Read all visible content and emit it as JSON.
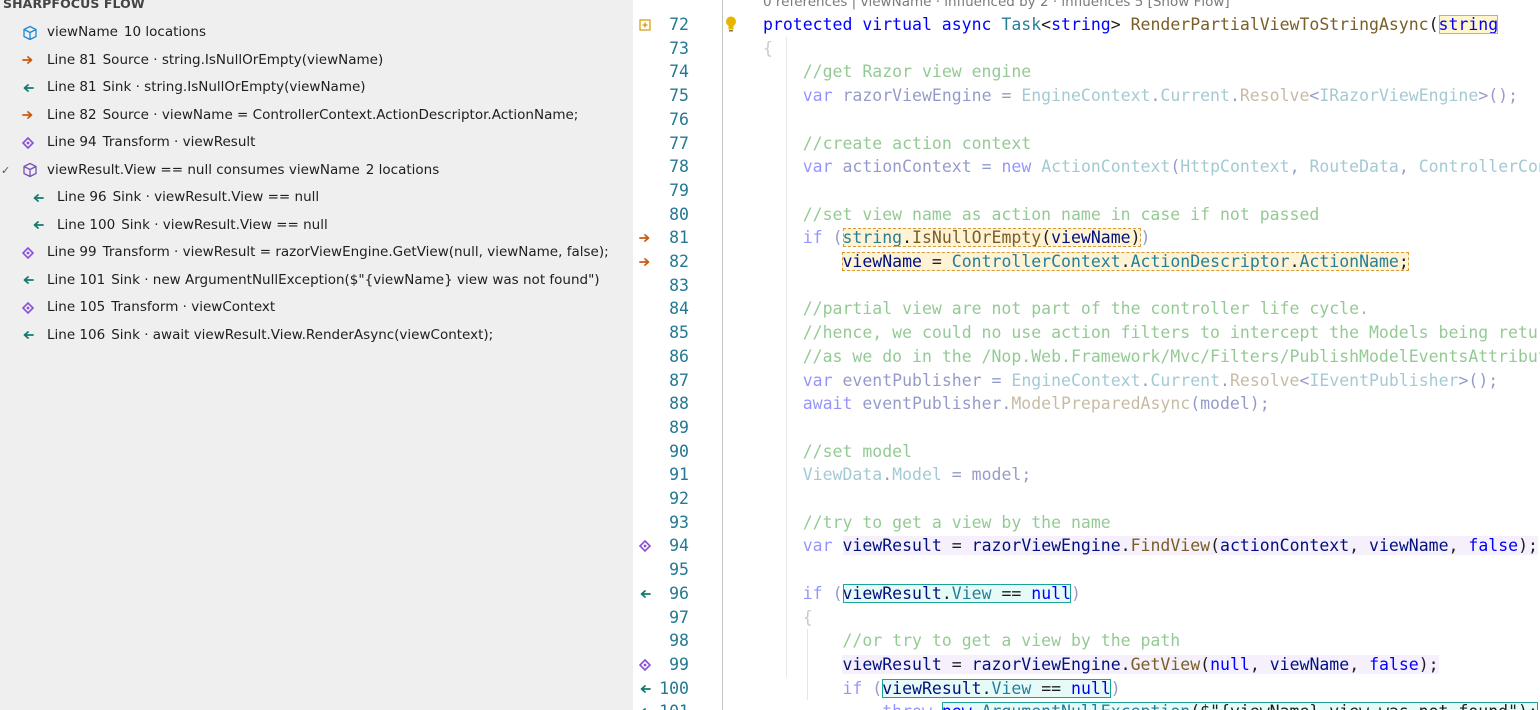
{
  "flow_panel": {
    "title": "SHARPFOCUS FLOW",
    "rows": [
      {
        "kind": "symbol",
        "checked": false,
        "indent": 0,
        "icon": "cube-icon",
        "text": "viewName",
        "count": "10 locations"
      },
      {
        "kind": "source",
        "indent": 0,
        "icon": "arrow-right-icon",
        "line": "Line 81",
        "text": "Source · string.IsNullOrEmpty(viewName)"
      },
      {
        "kind": "sink",
        "indent": 0,
        "icon": "arrow-left-icon",
        "line": "Line 81",
        "text": "Sink · string.IsNullOrEmpty(viewName)"
      },
      {
        "kind": "source",
        "indent": 0,
        "icon": "arrow-right-icon",
        "line": "Line 82",
        "text": "Source · viewName = ControllerContext.ActionDescriptor.ActionName;"
      },
      {
        "kind": "transform",
        "indent": 0,
        "icon": "diamond-icon",
        "line": "Line 94",
        "text": "Transform · viewResult"
      },
      {
        "kind": "symbol",
        "checked": true,
        "indent": 0,
        "icon": "cube-icon",
        "text": "viewResult.View == null consumes viewName",
        "count": "2 locations"
      },
      {
        "kind": "sink",
        "indent": 1,
        "icon": "arrow-left-icon",
        "line": "Line 96",
        "text": "Sink · viewResult.View == null"
      },
      {
        "kind": "sink",
        "indent": 1,
        "icon": "arrow-left-icon",
        "line": "Line 100",
        "text": "Sink · viewResult.View == null"
      },
      {
        "kind": "transform",
        "indent": 0,
        "icon": "diamond-icon",
        "line": "Line 99",
        "text": "Transform · viewResult = razorViewEngine.GetView(null, viewName, false);"
      },
      {
        "kind": "sink",
        "indent": 0,
        "icon": "arrow-left-icon",
        "line": "Line 101",
        "text": "Sink · new ArgumentNullException($\"{viewName} view was not found\")"
      },
      {
        "kind": "transform",
        "indent": 0,
        "icon": "diamond-icon",
        "line": "Line 105",
        "text": "Transform · viewContext"
      },
      {
        "kind": "sink",
        "indent": 0,
        "icon": "arrow-left-icon",
        "line": "Line 106",
        "text": "Sink · await viewResult.View.RenderAsync(viewContext);"
      }
    ]
  },
  "editor": {
    "codelens": "0 references | viewName · influenced by 2 · influences 5 [Show Flow]",
    "lines": [
      {
        "n": "72",
        "glyph": "fold-plus-icon",
        "tokens": [
          [
            "kw",
            "protected virtual async "
          ],
          [
            "ty",
            "Task"
          ],
          [
            "pl",
            "<"
          ],
          [
            "kw",
            "string"
          ],
          [
            "pl",
            "> "
          ],
          [
            "mt",
            "RenderPartialViewToStringAsync"
          ],
          [
            "pl",
            "("
          ],
          [
            "hp:kw",
            "string"
          ]
        ]
      },
      {
        "n": "73",
        "tokens": [
          [
            "fb",
            "{"
          ]
        ]
      },
      {
        "n": "74",
        "tokens": [
          [
            "ws",
            "    "
          ],
          [
            "fc",
            "//get Razor view engine"
          ]
        ]
      },
      {
        "n": "75",
        "tokens": [
          [
            "ws",
            "    "
          ],
          [
            "fk",
            "var "
          ],
          [
            "fv",
            "razorViewEngine = "
          ],
          [
            "ft",
            "EngineContext"
          ],
          [
            "fv",
            "."
          ],
          [
            "ft",
            "Current"
          ],
          [
            "fv",
            "."
          ],
          [
            "fm",
            "Resolve"
          ],
          [
            "fv",
            "<"
          ],
          [
            "ft",
            "IRazorViewEngine"
          ],
          [
            "fv",
            ">();"
          ]
        ]
      },
      {
        "n": "76",
        "tokens": []
      },
      {
        "n": "77",
        "tokens": [
          [
            "ws",
            "    "
          ],
          [
            "fc",
            "//create action context"
          ]
        ]
      },
      {
        "n": "78",
        "tokens": [
          [
            "ws",
            "    "
          ],
          [
            "fk",
            "var "
          ],
          [
            "fv",
            "actionContext = "
          ],
          [
            "fk",
            "new "
          ],
          [
            "ft",
            "ActionContext"
          ],
          [
            "fv",
            "("
          ],
          [
            "ft",
            "HttpContext"
          ],
          [
            "fv",
            ", "
          ],
          [
            "ft",
            "RouteData"
          ],
          [
            "fv",
            ", "
          ],
          [
            "ft",
            "ControllerContext"
          ]
        ]
      },
      {
        "n": "79",
        "tokens": []
      },
      {
        "n": "80",
        "tokens": [
          [
            "ws",
            "    "
          ],
          [
            "fc",
            "//set view name as action name in case if not passed"
          ]
        ]
      },
      {
        "n": "81",
        "glyph": "arrow-right-icon",
        "tokens": [
          [
            "ws",
            "    "
          ],
          [
            "fk",
            "if "
          ],
          [
            "fv",
            "("
          ],
          [
            "hs:ty",
            "string"
          ],
          [
            "hs:pl",
            "."
          ],
          [
            "hs:mt",
            "IsNullOrEmpty"
          ],
          [
            "hs:pl",
            "("
          ],
          [
            "hs:vr",
            "viewName"
          ],
          [
            "hs:pl",
            ")"
          ],
          [
            "fv",
            ")"
          ]
        ]
      },
      {
        "n": "82",
        "glyph": "arrow-right-icon",
        "tokens": [
          [
            "ws",
            "        "
          ],
          [
            "hs:vr",
            "viewName"
          ],
          [
            "hs:pl",
            " = "
          ],
          [
            "hs:ty",
            "ControllerContext"
          ],
          [
            "hs:pl",
            "."
          ],
          [
            "hs:ty",
            "ActionDescriptor"
          ],
          [
            "hs:pl",
            "."
          ],
          [
            "hs:ty",
            "ActionName"
          ],
          [
            "hs:pl",
            ";"
          ]
        ]
      },
      {
        "n": "83",
        "tokens": []
      },
      {
        "n": "84",
        "tokens": [
          [
            "ws",
            "    "
          ],
          [
            "fc",
            "//partial view are not part of the controller life cycle."
          ]
        ]
      },
      {
        "n": "85",
        "tokens": [
          [
            "ws",
            "    "
          ],
          [
            "fc",
            "//hence, we could no use action filters to intercept the Models being returned"
          ]
        ]
      },
      {
        "n": "86",
        "tokens": [
          [
            "ws",
            "    "
          ],
          [
            "fc",
            "//as we do in the /Nop.Web.Framework/Mvc/Filters/PublishModelEventsAttribute.cs"
          ]
        ]
      },
      {
        "n": "87",
        "tokens": [
          [
            "ws",
            "    "
          ],
          [
            "fk",
            "var "
          ],
          [
            "fv",
            "eventPublisher = "
          ],
          [
            "ft",
            "EngineContext"
          ],
          [
            "fv",
            "."
          ],
          [
            "ft",
            "Current"
          ],
          [
            "fv",
            "."
          ],
          [
            "fm",
            "Resolve"
          ],
          [
            "fv",
            "<"
          ],
          [
            "ft",
            "IEventPublisher"
          ],
          [
            "fv",
            ">();"
          ]
        ]
      },
      {
        "n": "88",
        "tokens": [
          [
            "ws",
            "    "
          ],
          [
            "fk",
            "await "
          ],
          [
            "fv",
            "eventPublisher."
          ],
          [
            "fm",
            "ModelPreparedAsync"
          ],
          [
            "fv",
            "(model);"
          ]
        ]
      },
      {
        "n": "89",
        "tokens": []
      },
      {
        "n": "90",
        "tokens": [
          [
            "ws",
            "    "
          ],
          [
            "fc",
            "//set model"
          ]
        ]
      },
      {
        "n": "91",
        "tokens": [
          [
            "ws",
            "    "
          ],
          [
            "ft",
            "ViewData"
          ],
          [
            "fv",
            "."
          ],
          [
            "ft",
            "Model"
          ],
          [
            "fv",
            " = model;"
          ]
        ]
      },
      {
        "n": "92",
        "tokens": []
      },
      {
        "n": "93",
        "tokens": [
          [
            "ws",
            "    "
          ],
          [
            "fc",
            "//try to get a view by the name"
          ]
        ]
      },
      {
        "n": "94",
        "glyph": "diamond-icon",
        "tokens": [
          [
            "ws",
            "    "
          ],
          [
            "fk",
            "var "
          ],
          [
            "ht:vr",
            "viewResult"
          ],
          [
            "ht:pl",
            " = "
          ],
          [
            "ht:vr",
            "razorViewEngine"
          ],
          [
            "ht:pl",
            "."
          ],
          [
            "ht:mt",
            "FindView"
          ],
          [
            "ht:pl",
            "("
          ],
          [
            "ht:vr",
            "actionContext"
          ],
          [
            "ht:pl",
            ", "
          ],
          [
            "ht:vr",
            "viewName"
          ],
          [
            "ht:pl",
            ", "
          ],
          [
            "ht:kw",
            "false"
          ],
          [
            "ht:pl",
            ");"
          ]
        ]
      },
      {
        "n": "95",
        "tokens": []
      },
      {
        "n": "96",
        "glyph": "arrow-left-icon",
        "tokens": [
          [
            "ws",
            "    "
          ],
          [
            "fk",
            "if "
          ],
          [
            "fv",
            "("
          ],
          [
            "hk:vr",
            "viewResult"
          ],
          [
            "hk:pl",
            "."
          ],
          [
            "hk:ty",
            "View"
          ],
          [
            "hk:pl",
            " == "
          ],
          [
            "hk:kw",
            "null"
          ],
          [
            "fv",
            ")"
          ]
        ]
      },
      {
        "n": "97",
        "tokens": [
          [
            "ws",
            "    "
          ],
          [
            "fb",
            "{"
          ]
        ]
      },
      {
        "n": "98",
        "tokens": [
          [
            "ws",
            "        "
          ],
          [
            "fc",
            "//or try to get a view by the path"
          ]
        ]
      },
      {
        "n": "99",
        "glyph": "diamond-icon",
        "tokens": [
          [
            "ws",
            "        "
          ],
          [
            "ht:vr",
            "viewResult"
          ],
          [
            "ht:pl",
            " = "
          ],
          [
            "ht:vr",
            "razorViewEngine"
          ],
          [
            "ht:pl",
            "."
          ],
          [
            "ht:mt",
            "GetView"
          ],
          [
            "ht:pl",
            "("
          ],
          [
            "ht:kw",
            "null"
          ],
          [
            "ht:pl",
            ", "
          ],
          [
            "ht:vr",
            "viewName"
          ],
          [
            "ht:pl",
            ", "
          ],
          [
            "ht:kw",
            "false"
          ],
          [
            "ht:pl",
            ");"
          ]
        ]
      },
      {
        "n": "100",
        "glyph": "arrow-left-icon",
        "tokens": [
          [
            "ws",
            "        "
          ],
          [
            "fk",
            "if "
          ],
          [
            "fv",
            "("
          ],
          [
            "hk:vr",
            "viewResult"
          ],
          [
            "hk:pl",
            "."
          ],
          [
            "hk:ty",
            "View"
          ],
          [
            "hk:pl",
            " == "
          ],
          [
            "hk:kw",
            "null"
          ],
          [
            "fv",
            ")"
          ]
        ]
      },
      {
        "n": "101",
        "glyph": "arrow-left-icon",
        "tokens": [
          [
            "ws",
            "            "
          ],
          [
            "fk",
            "throw "
          ],
          [
            "hk:kw",
            "new "
          ],
          [
            "hk:ty",
            "ArgumentNullException"
          ],
          [
            "hk:pl",
            "($\"{viewName} view was not found\");"
          ]
        ]
      }
    ]
  },
  "colors": {
    "source": "#c75b12",
    "sink": "#147a6e",
    "transform": "#8a4fd8",
    "cube": "#1f8ad2",
    "cube_checked": "#7a4fb8",
    "lightbulb": "#e8b400",
    "fold": "#d49a00"
  }
}
